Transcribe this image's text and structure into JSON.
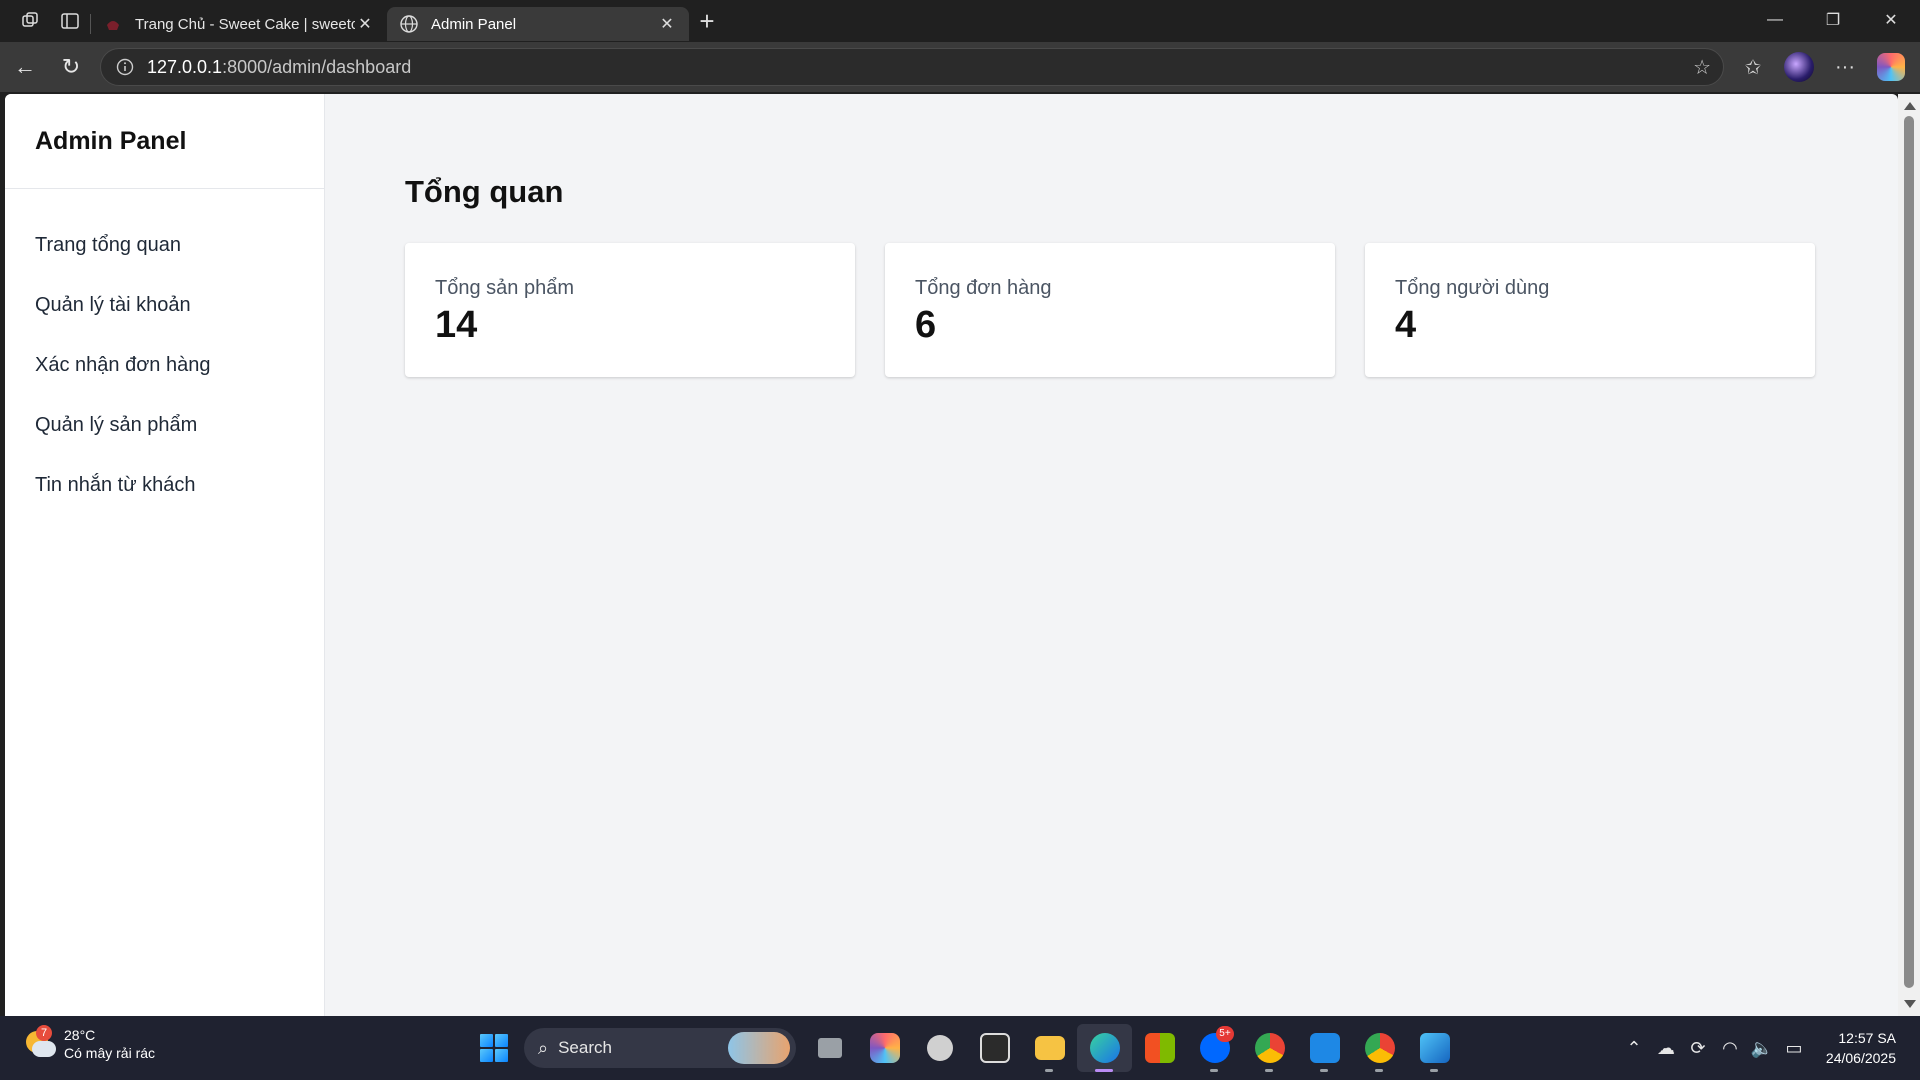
{
  "browser": {
    "tabs": [
      {
        "title": "Trang Chủ - Sweet Cake | sweetcake",
        "active": false
      },
      {
        "title": "Admin Panel",
        "active": true
      }
    ],
    "url_host": "127.0.0.1",
    "url_path": ":8000/admin/dashboard"
  },
  "sidebar": {
    "brand": "Admin Panel",
    "items": [
      {
        "label": "Trang tổng quan"
      },
      {
        "label": "Quản lý tài khoản"
      },
      {
        "label": "Xác nhận đơn hàng"
      },
      {
        "label": "Quản lý sản phẩm"
      },
      {
        "label": "Tin nhắn từ khách"
      }
    ]
  },
  "main": {
    "title": "Tổng quan",
    "cards": [
      {
        "label": "Tổng sản phẩm",
        "value": "14"
      },
      {
        "label": "Tổng đơn hàng",
        "value": "6"
      },
      {
        "label": "Tổng người dùng",
        "value": "4"
      }
    ]
  },
  "taskbar": {
    "weather": {
      "temp": "28°C",
      "desc": "Có mây rải rác",
      "badge": "7"
    },
    "search_label": "Search",
    "zalo_badge": "5+",
    "clock_time": "12:57 SA",
    "clock_date": "24/06/2025"
  }
}
